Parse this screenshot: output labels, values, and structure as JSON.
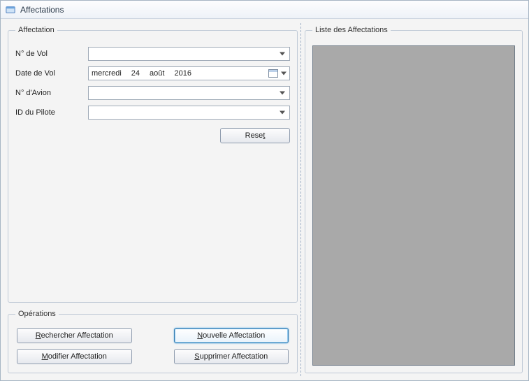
{
  "window": {
    "title": "Affectations"
  },
  "groups": {
    "affectation": "Affectation",
    "operations": "Opérations",
    "liste": "Liste des Affectations"
  },
  "form": {
    "numVol": {
      "label": "N° de Vol",
      "value": ""
    },
    "dateVol": {
      "label": "Date de Vol",
      "weekday": "mercredi",
      "day": "24",
      "month": "août",
      "year": "2016"
    },
    "numAvion": {
      "label": "N° d'Avion",
      "value": ""
    },
    "idPilote": {
      "label": "ID du Pilote",
      "value": ""
    },
    "reset": {
      "prefix": "Rese",
      "ul": "t",
      "suffix": ""
    }
  },
  "ops": {
    "rechercher": {
      "ul": "R",
      "rest": "echercher Affectation"
    },
    "nouvelle": {
      "ul": "N",
      "rest": "ouvelle Affectation"
    },
    "modifier": {
      "ul": "M",
      "rest": "odifier Affectation"
    },
    "supprimer": {
      "ul": "S",
      "rest": "upprimer Affectation"
    }
  }
}
